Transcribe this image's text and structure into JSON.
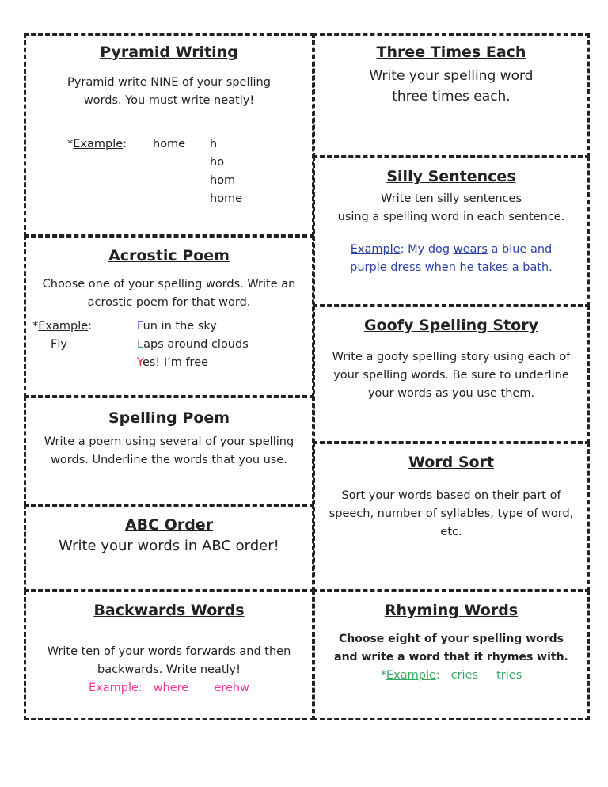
{
  "pyramid": {
    "title": "Pyramid Writing",
    "text": "Pyramid write NINE of your spelling words.  You must write neatly!",
    "ex_prefix": "*",
    "ex_label": "Example",
    "ex_colon": ":",
    "word": "home",
    "steps": [
      "h",
      "ho",
      "hom",
      "home"
    ]
  },
  "three": {
    "title": "Three Times Each",
    "text": "Write your spelling word three times each."
  },
  "silly": {
    "title": "Silly Sentences",
    "text1": "Write ten silly sentences",
    "text2": "using a spelling word in each sentence.",
    "ex_label": "Example",
    "ex_a": ":  My dog ",
    "ex_word": "wears",
    "ex_b": " a blue and purple dress when he takes a bath.",
    "color": "#2a3fa8"
  },
  "acrostic": {
    "title": "Acrostic Poem",
    "text": "Choose one of your spelling words.  Write an acrostic poem for that word.",
    "ex_prefix": "*",
    "ex_label": "Example",
    "ex_colon": ":",
    "word": "Fly",
    "lines": [
      {
        "letter": "F",
        "rest": "un in the sky",
        "color": "#1f3fe0"
      },
      {
        "letter": "L",
        "rest": "aps around clouds",
        "color": "#3a9a5a"
      },
      {
        "letter": "Y",
        "rest": "es!  I’m free",
        "color": "#e81d1d"
      }
    ]
  },
  "goofy": {
    "title": "Goofy Spelling Story",
    "text": "Write a goofy spelling story using each of your spelling words.  Be sure to underline your words as you use them."
  },
  "poem": {
    "title": "Spelling Poem",
    "text": "Write a poem using several of your spelling words.  Underline the words that you use."
  },
  "sort": {
    "title": "Word Sort",
    "text": "Sort your words based on their part of speech, number of syllables, type of word, etc."
  },
  "abc": {
    "title": "ABC Order",
    "text": "Write your words in ABC order!"
  },
  "backwards": {
    "title": "Backwards Words",
    "text_a": "Write ",
    "text_u": "ten",
    "text_b": " of your words forwards and then backwards.  Write neatly!",
    "ex_label": "Example:",
    "ex_word": "where",
    "ex_rev": "erehw",
    "color": "#f0359a"
  },
  "rhyming": {
    "title": "Rhyming Words",
    "text": "Choose eight of your spelling words and write a word that it rhymes with.",
    "ex_prefix": "*",
    "ex_label": "Example",
    "ex_colon": ":",
    "ex_word": "cries",
    "ex_rhyme": "tries",
    "color": "#3aa862"
  }
}
